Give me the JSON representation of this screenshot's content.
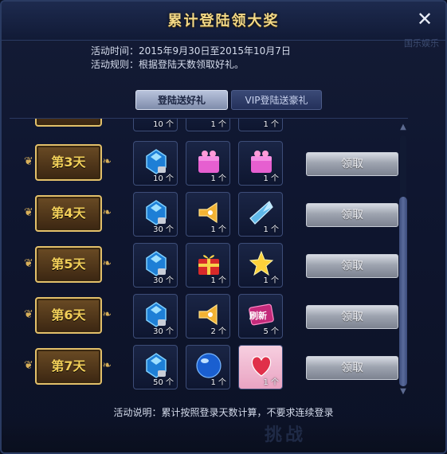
{
  "window": {
    "title": "累计登陆领大奖",
    "close_icon": "close-icon",
    "watermark": "国乐娱乐"
  },
  "info": {
    "time_line": "活动时间：2015年9月30日至2015年10月7日",
    "rule_line": "活动规则：根据登陆天数领取好礼。"
  },
  "tabs": [
    {
      "label": "登陆送好礼",
      "active": true
    },
    {
      "label": "VIP登陆送豪礼",
      "active": false
    }
  ],
  "partial_row": {
    "counts": [
      "10 个",
      "1 个",
      "1 个"
    ]
  },
  "rows": [
    {
      "day": "第3天",
      "items": [
        {
          "icon": "blue-gem-icon",
          "count": "10 个",
          "locked": true
        },
        {
          "icon": "pink-gift-box-icon",
          "count": "1 个"
        },
        {
          "icon": "pink-gift-box-icon",
          "count": "1 个"
        }
      ],
      "button": "领取"
    },
    {
      "day": "第4天",
      "items": [
        {
          "icon": "blue-gem-icon",
          "count": "30 个",
          "locked": true
        },
        {
          "icon": "megaphone-icon",
          "count": "1 个"
        },
        {
          "icon": "crystal-shard-icon",
          "count": "1 个"
        }
      ],
      "button": "领取"
    },
    {
      "day": "第5天",
      "items": [
        {
          "icon": "blue-gem-icon",
          "count": "30 个",
          "locked": true
        },
        {
          "icon": "red-gift-box-icon",
          "count": "1 个"
        },
        {
          "icon": "star-icon",
          "count": "1 个"
        }
      ],
      "button": "领取"
    },
    {
      "day": "第6天",
      "items": [
        {
          "icon": "blue-gem-icon",
          "count": "30 个",
          "locked": true
        },
        {
          "icon": "megaphone-icon",
          "count": "2 个"
        },
        {
          "icon": "refresh-card-icon",
          "label": "刷新",
          "count": "5 个"
        }
      ],
      "button": "领取"
    },
    {
      "day": "第7天",
      "items": [
        {
          "icon": "blue-gem-icon",
          "count": "50 个",
          "locked": true
        },
        {
          "icon": "blue-orb-icon",
          "count": "1 个"
        },
        {
          "icon": "heart-icon",
          "count": "1 个"
        }
      ],
      "button": "领取"
    }
  ],
  "footer": "活动说明：累计按照登录天数计算，不要求连续登录",
  "background_text": "挑战",
  "colors": {
    "gold": "#f2cf59",
    "panel": "#0f1630",
    "button": "#9ea4b0"
  }
}
